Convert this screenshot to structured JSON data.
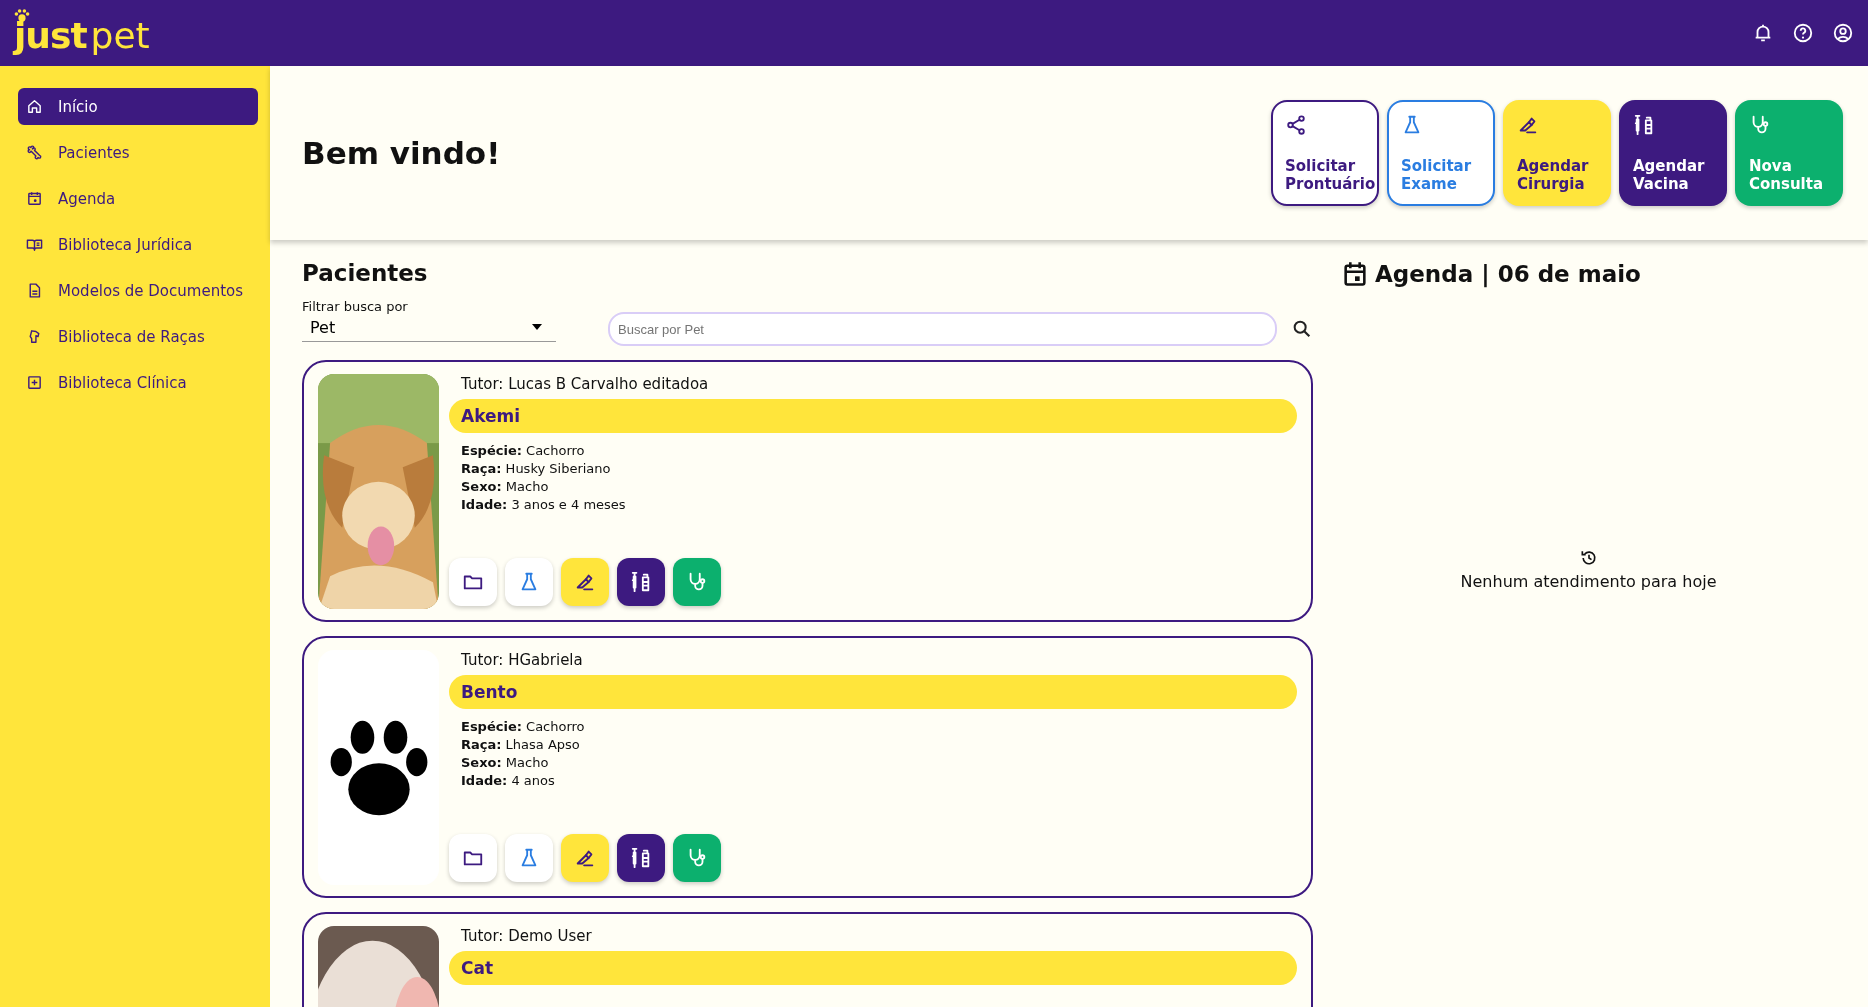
{
  "header": {
    "logo_bold": "just",
    "logo_light": "pet"
  },
  "sidebar": {
    "items": [
      {
        "label": "Início",
        "kind": "home",
        "selected": true
      },
      {
        "label": "Pacientes",
        "kind": "bone",
        "selected": false
      },
      {
        "label": "Agenda",
        "kind": "calendar",
        "selected": false
      },
      {
        "label": "Biblioteca Jurídica",
        "kind": "book",
        "selected": false
      },
      {
        "label": "Modelos de Documentos",
        "kind": "document",
        "selected": false
      },
      {
        "label": "Biblioteca de Raças",
        "kind": "dog",
        "selected": false
      },
      {
        "label": "Biblioteca Clínica",
        "kind": "plus",
        "selected": false
      }
    ]
  },
  "welcome": "Bem vindo!",
  "quick_actions": [
    {
      "label": "Solicitar Prontuário",
      "kind": "share"
    },
    {
      "label": "Solicitar Exame",
      "kind": "exam"
    },
    {
      "label": "Agendar Cirurgia",
      "kind": "surgery"
    },
    {
      "label": "Agendar Vacina",
      "kind": "vaccine"
    },
    {
      "label": "Nova Consulta",
      "kind": "consult"
    }
  ],
  "patients": {
    "title": "Pacientes",
    "filter_label": "Filtrar busca por",
    "filter_value": "Pet",
    "search": {
      "placeholder": "Buscar por Pet"
    },
    "cards": [
      {
        "tutor": "Tutor: Lucas B Carvalho editadoa",
        "name": "Akemi",
        "kind": "dog",
        "fields": [
          {
            "label": "Espécie:",
            "value": "Cachorro"
          },
          {
            "label": "Raça:",
            "value": "Husky Siberiano"
          },
          {
            "label": "Sexo:",
            "value": "Macho"
          },
          {
            "label": "Idade:",
            "value": "3 anos e 4 meses"
          }
        ]
      },
      {
        "tutor": "Tutor: HGabriela",
        "name": "Bento",
        "kind": "paw",
        "fields": [
          {
            "label": "Espécie:",
            "value": "Cachorro"
          },
          {
            "label": "Raça:",
            "value": "Lhasa Apso"
          },
          {
            "label": "Sexo:",
            "value": "Macho"
          },
          {
            "label": "Idade:",
            "value": "4 anos"
          }
        ]
      },
      {
        "tutor": "Tutor: Demo User",
        "name": "Cat",
        "kind": "cat"
      }
    ]
  },
  "agenda": {
    "title": "Agenda | 06 de maio",
    "empty": "Nenhum atendimento para hoje"
  }
}
